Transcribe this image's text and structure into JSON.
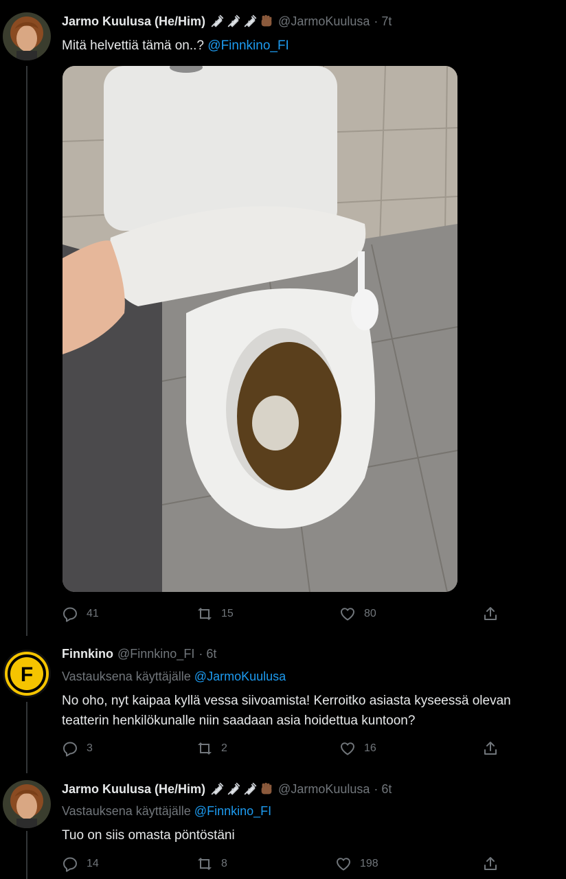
{
  "tweets": [
    {
      "name": "Jarmo Kuulusa (He/Him)",
      "handle": "@JarmoKuulusa",
      "time": "· 7t",
      "text": "Mitä helvettiä tämä on..?",
      "mention": "@Finnkino_FI",
      "replies": "41",
      "retweets": "15",
      "likes": "80"
    },
    {
      "name": "Finnkino",
      "handle": "@Finnkino_FI",
      "time": "· 6t",
      "replying_prefix": "Vastauksena käyttäjälle",
      "replying_to": "@JarmoKuulusa",
      "text_line1": "No oho, nyt kaipaa kyllä vessa siivoamista! Kerroitko asiasta kyseessä olevan",
      "text_line2": "teatterin henkilökunalle niin saadaan asia hoidettua kuntoon?",
      "avatar_letter": "F",
      "replies": "3",
      "retweets": "2",
      "likes": "16"
    },
    {
      "name": "Jarmo Kuulusa (He/Him)",
      "handle": "@JarmoKuulusa",
      "time": "· 6t",
      "replying_prefix": "Vastauksena käyttäjälle",
      "replying_to": "@Finnkino_FI",
      "text": "Tuo on siis omasta pöntöstäni",
      "replies": "14",
      "retweets": "8",
      "likes": "198"
    }
  ],
  "colors": {
    "background": "#000000",
    "text": "#e7e9ea",
    "secondary": "#71767b",
    "link": "#1d9bf0",
    "finnkino_yellow": "#f5c400"
  },
  "icons": [
    "syringe-icon",
    "raised-fist-icon",
    "reply-icon",
    "retweet-icon",
    "like-icon",
    "share-icon"
  ]
}
